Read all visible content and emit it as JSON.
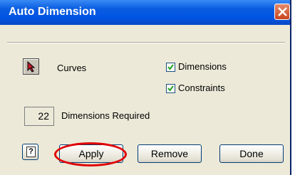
{
  "window": {
    "title": "Auto Dimension"
  },
  "tools": {
    "curves_label": "Curves"
  },
  "options": {
    "dimensions": {
      "label": "Dimensions",
      "checked": true
    },
    "constraints": {
      "label": "Constraints",
      "checked": true
    }
  },
  "status": {
    "count": "22",
    "count_label": "Dimensions Required"
  },
  "buttons": {
    "apply": "Apply",
    "remove": "Remove",
    "done": "Done"
  },
  "annotation": {
    "highlight_color": "#e00000"
  },
  "colors": {
    "titlebar": "#0054e3",
    "dialog_bg": "#ece9d8",
    "close": "#c9431c"
  }
}
